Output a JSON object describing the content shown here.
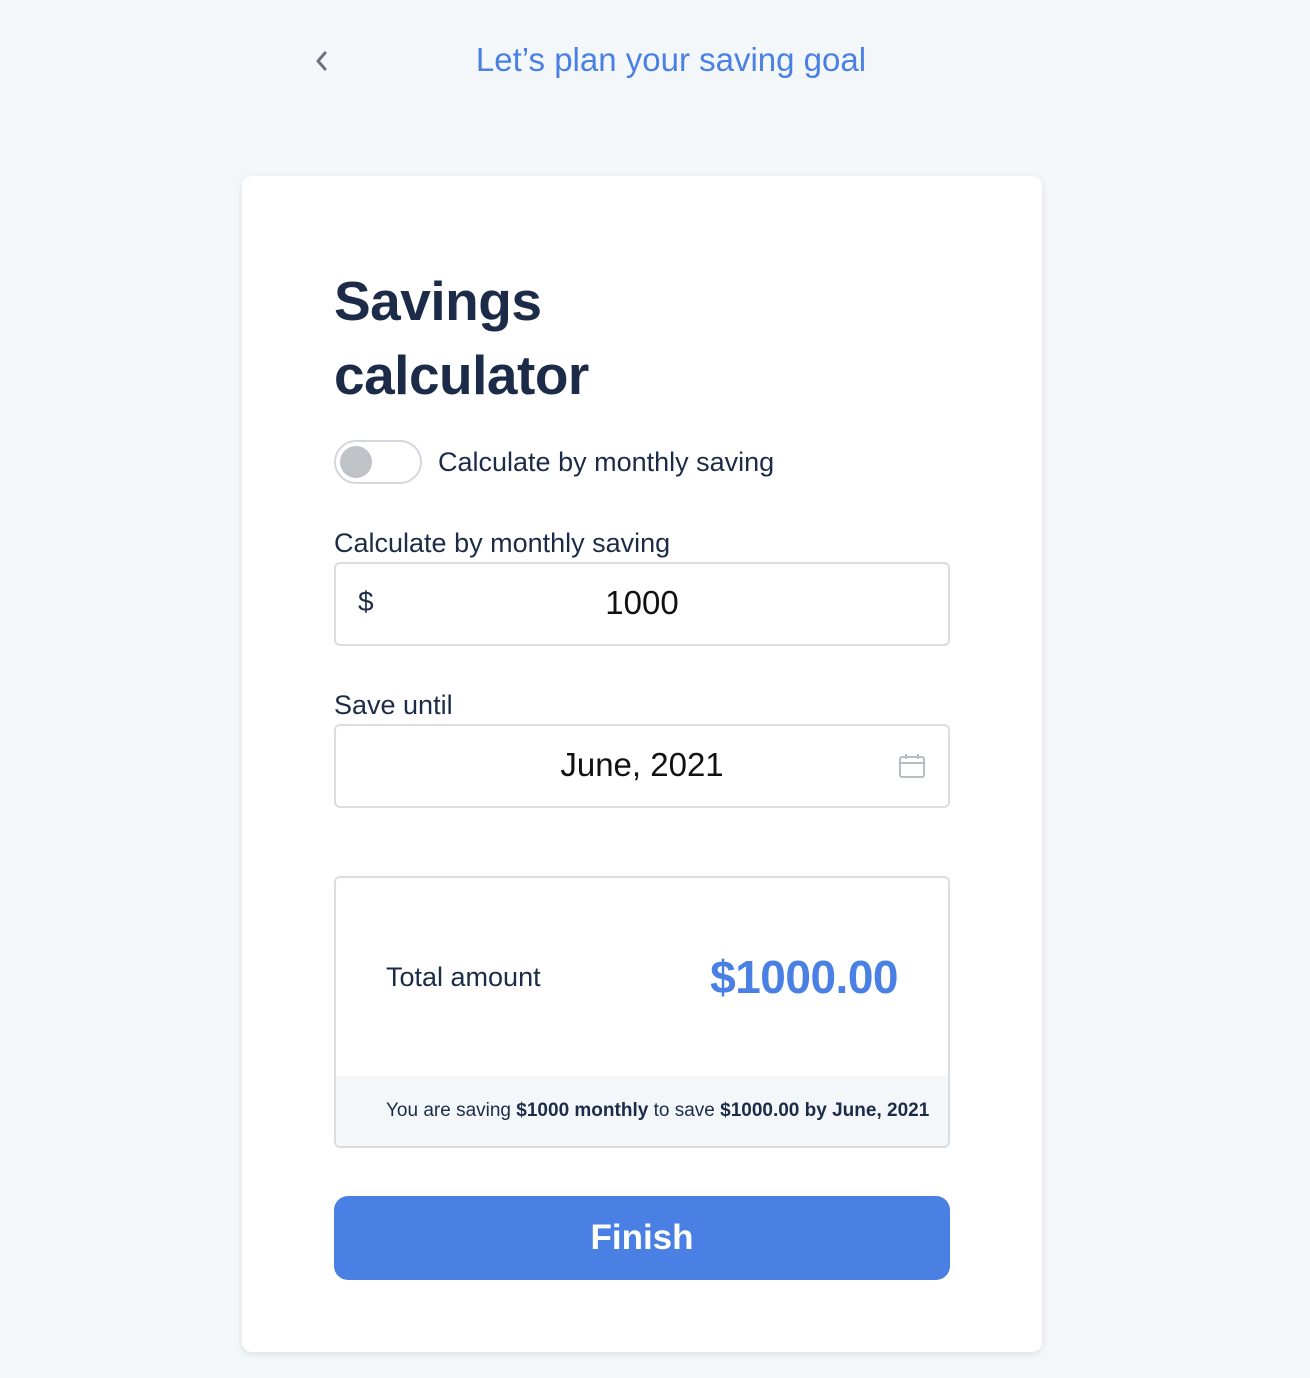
{
  "header": {
    "title": "Let’s plan your saving goal",
    "back_icon": "chevron-left-icon"
  },
  "calculator": {
    "title_line1": "Savings",
    "title_line2": "calculator",
    "toggle": {
      "label": "Calculate by monthly saving",
      "state": "off"
    },
    "monthly_field": {
      "label": "Calculate by monthly saving",
      "currency": "$",
      "value": "1000"
    },
    "date_field": {
      "label": "Save until",
      "value": "June, 2021",
      "icon": "calendar-icon"
    },
    "summary": {
      "total_label": "Total amount",
      "total_value": "$1000.00",
      "text_prefix": "You are saving",
      "text_monthly": "$1000 monthly",
      "text_middle": "to save",
      "text_result": "$1000.00 by June, 2021"
    },
    "finish_label": "Finish"
  },
  "colors": {
    "accent": "#4a80e3",
    "text_dark": "#1c2b48",
    "background": "#f4f7fa",
    "toggle_knob": "#bfc2c6"
  }
}
